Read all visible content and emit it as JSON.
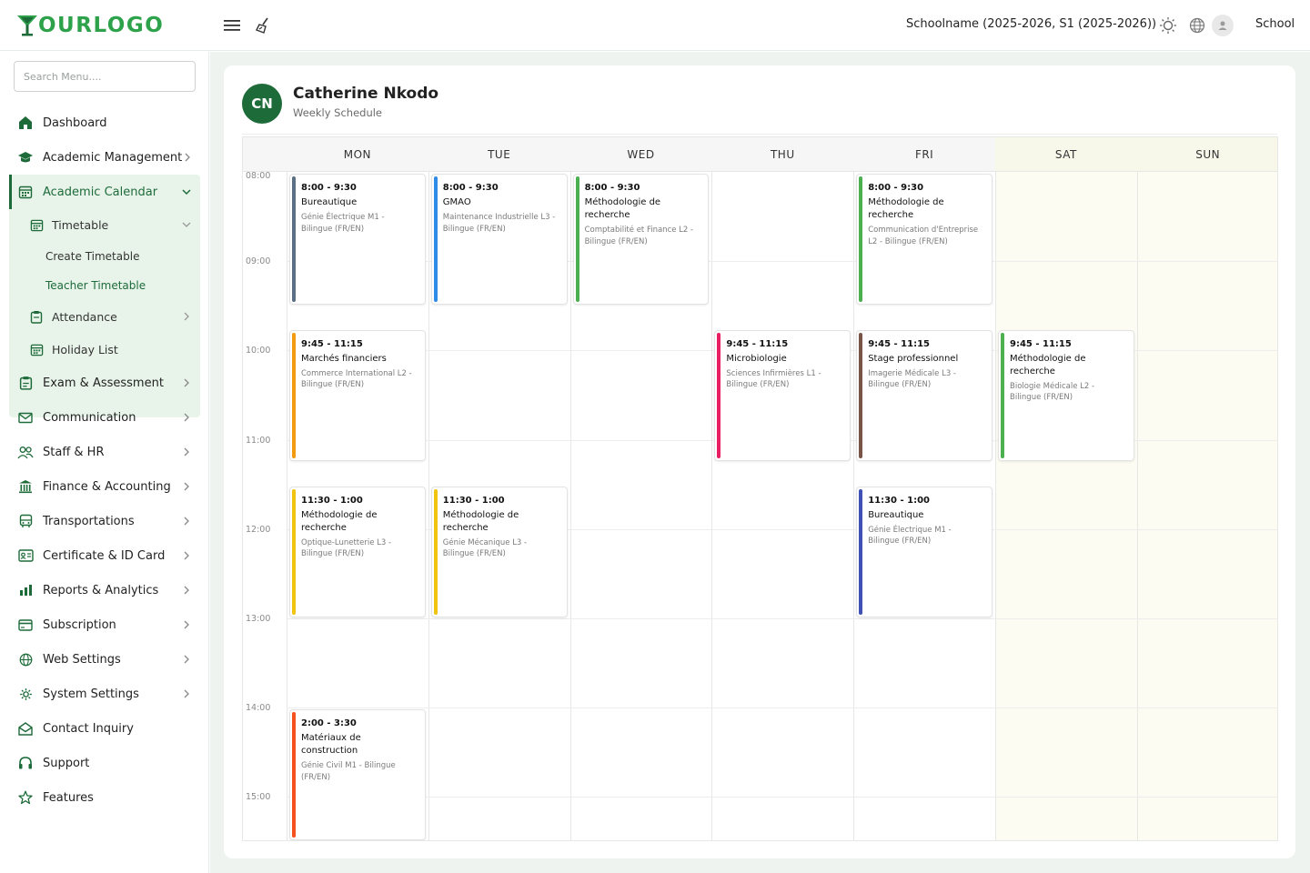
{
  "header": {
    "logo_text": "OURLOGO",
    "school": "Schoolname (2025-2026, S1 (2025-2026))",
    "user": "School"
  },
  "sidebar": {
    "search_placeholder": "Search Menu....",
    "items": [
      {
        "label": "Dashboard",
        "icon": "home-icon"
      },
      {
        "label": "Academic Management",
        "icon": "graduation-cap-icon"
      },
      {
        "label": "Academic Calendar",
        "icon": "calendar-icon"
      },
      {
        "label": "Timetable",
        "icon": "calendar-icon"
      },
      {
        "label": "Create Timetable"
      },
      {
        "label": "Teacher Timetable"
      },
      {
        "label": "Attendance",
        "icon": "clipboard-icon"
      },
      {
        "label": "Holiday List",
        "icon": "calendar-icon"
      },
      {
        "label": "Exam & Assessment",
        "icon": "clipboard-icon"
      },
      {
        "label": "Communication",
        "icon": "mail-icon"
      },
      {
        "label": "Staff & HR",
        "icon": "users-icon"
      },
      {
        "label": "Finance & Accounting",
        "icon": "bank-icon"
      },
      {
        "label": "Transportations",
        "icon": "bus-icon"
      },
      {
        "label": "Certificate & ID Card",
        "icon": "id-card-icon"
      },
      {
        "label": "Reports & Analytics",
        "icon": "bar-chart-icon"
      },
      {
        "label": "Subscription",
        "icon": "credit-card-icon"
      },
      {
        "label": "Web Settings",
        "icon": "globe-icon"
      },
      {
        "label": "System Settings",
        "icon": "gear-icon"
      },
      {
        "label": "Contact Inquiry",
        "icon": "envelope-open-icon"
      },
      {
        "label": "Support",
        "icon": "headset-icon"
      },
      {
        "label": "Features",
        "icon": "star-icon"
      }
    ]
  },
  "teacher": {
    "initials": "CN",
    "name": "Catherine Nkodo",
    "subtitle": "Weekly Schedule"
  },
  "days": [
    "MON",
    "TUE",
    "WED",
    "THU",
    "FRI",
    "SAT",
    "SUN"
  ],
  "times": [
    "08:00",
    "09:00",
    "10:00",
    "11:00",
    "12:00",
    "13:00",
    "14:00",
    "15:00"
  ],
  "colors": {
    "brand": "#1e6b3a",
    "logo": "#2da24a"
  },
  "events": [
    {
      "day": 0,
      "start": 8.0,
      "end": 9.5,
      "time": "8:00 - 9:30",
      "subject": "Bureautique",
      "detail": "Génie Électrique M1 - Bilingue (FR/EN)",
      "color": "#5b7085"
    },
    {
      "day": 1,
      "start": 8.0,
      "end": 9.5,
      "time": "8:00 - 9:30",
      "subject": "GMAO",
      "detail": "Maintenance Industrielle L3 - Bilingue (FR/EN)",
      "color": "#2f8be6"
    },
    {
      "day": 2,
      "start": 8.0,
      "end": 9.5,
      "time": "8:00 - 9:30",
      "subject": "Méthodologie de recherche",
      "detail": "Comptabilité et Finance L2 - Bilingue (FR/EN)",
      "color": "#4caf50"
    },
    {
      "day": 4,
      "start": 8.0,
      "end": 9.5,
      "time": "8:00 - 9:30",
      "subject": "Méthodologie de recherche",
      "detail": "Communication d'Entreprise L2 - Bilingue (FR/EN)",
      "color": "#4caf50"
    },
    {
      "day": 0,
      "start": 9.75,
      "end": 11.25,
      "time": "9:45 - 11:15",
      "subject": "Marchés financiers",
      "detail": "Commerce International L2 - Bilingue (FR/EN)",
      "color": "#f39c12"
    },
    {
      "day": 3,
      "start": 9.75,
      "end": 11.25,
      "time": "9:45 - 11:15",
      "subject": "Microbiologie",
      "detail": "Sciences Infirmières L1 - Bilingue (FR/EN)",
      "color": "#e91e63"
    },
    {
      "day": 4,
      "start": 9.75,
      "end": 11.25,
      "time": "9:45 - 11:15",
      "subject": "Stage professionnel",
      "detail": "Imagerie Médicale L3 - Bilingue (FR/EN)",
      "color": "#795548"
    },
    {
      "day": 5,
      "start": 9.75,
      "end": 11.25,
      "time": "9:45 - 11:15",
      "subject": "Méthodologie de recherche",
      "detail": "Biologie Médicale L2 - Bilingue (FR/EN)",
      "color": "#4caf50"
    },
    {
      "day": 0,
      "start": 11.5,
      "end": 13.0,
      "time": "11:30 - 1:00",
      "subject": "Méthodologie de recherche",
      "detail": "Optique-Lunetterie L3 - Bilingue (FR/EN)",
      "color": "#f1c40f"
    },
    {
      "day": 1,
      "start": 11.5,
      "end": 13.0,
      "time": "11:30 - 1:00",
      "subject": "Méthodologie de recherche",
      "detail": "Génie Mécanique L3 - Bilingue (FR/EN)",
      "color": "#f1c40f"
    },
    {
      "day": 4,
      "start": 11.5,
      "end": 13.0,
      "time": "11:30 - 1:00",
      "subject": "Bureautique",
      "detail": "Génie Électrique M1 - Bilingue (FR/EN)",
      "color": "#3f51b5"
    },
    {
      "day": 0,
      "start": 14.0,
      "end": 15.5,
      "time": "2:00 - 3:30",
      "subject": "Matériaux de construction",
      "detail": "Génie Civil M1 - Bilingue (FR/EN)",
      "color": "#f4511e"
    }
  ]
}
